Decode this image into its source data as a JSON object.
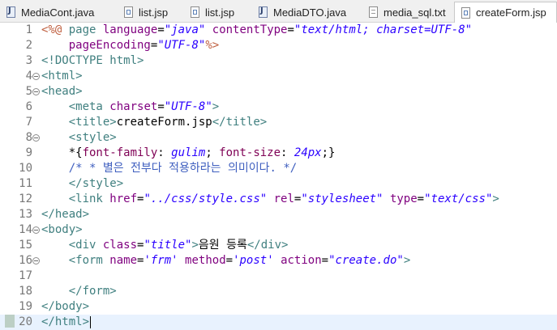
{
  "tabs": [
    {
      "label": "MediaCont.java",
      "icon": "java-file-icon"
    },
    {
      "label": "list.jsp",
      "icon": "jsp-file-icon"
    },
    {
      "label": "list.jsp",
      "icon": "jsp-file-icon"
    },
    {
      "label": "MediaDTO.java",
      "icon": "java-file-icon"
    },
    {
      "label": "media_sql.txt",
      "icon": "text-file-icon"
    },
    {
      "label": "createForm.jsp",
      "icon": "jsp-file-icon",
      "active": true
    }
  ],
  "current_line": 20,
  "lines": [
    {
      "number": "1",
      "fold": false,
      "tokens": [
        [
          "j",
          "<%@ "
        ],
        [
          "t",
          "page "
        ],
        [
          "a",
          "language"
        ],
        [
          "p",
          "="
        ],
        [
          "v",
          "\"java\""
        ],
        [
          "p",
          " "
        ],
        [
          "a",
          "contentType"
        ],
        [
          "p",
          "="
        ],
        [
          "v",
          "\"text/html; charset=UTF-8\""
        ]
      ]
    },
    {
      "number": "2",
      "fold": false,
      "tokens": [
        [
          "p",
          "    "
        ],
        [
          "a",
          "pageEncoding"
        ],
        [
          "p",
          "="
        ],
        [
          "v",
          "\"UTF-8\""
        ],
        [
          "j",
          "%>"
        ]
      ]
    },
    {
      "number": "3",
      "fold": false,
      "tokens": [
        [
          "t",
          "<!DOCTYPE html>"
        ]
      ]
    },
    {
      "number": "4",
      "fold": true,
      "tokens": [
        [
          "t",
          "<html>"
        ]
      ]
    },
    {
      "number": "5",
      "fold": true,
      "tokens": [
        [
          "t",
          "<head>"
        ]
      ]
    },
    {
      "number": "6",
      "fold": false,
      "tokens": [
        [
          "p",
          "    "
        ],
        [
          "t",
          "<meta "
        ],
        [
          "a",
          "charset"
        ],
        [
          "p",
          "="
        ],
        [
          "v",
          "\"UTF-8\""
        ],
        [
          "t",
          ">"
        ]
      ]
    },
    {
      "number": "7",
      "fold": false,
      "tokens": [
        [
          "p",
          "    "
        ],
        [
          "t",
          "<title>"
        ],
        [
          "p",
          "createForm.jsp"
        ],
        [
          "t",
          "</title>"
        ]
      ]
    },
    {
      "number": "8",
      "fold": true,
      "tokens": [
        [
          "p",
          "    "
        ],
        [
          "t",
          "<style>"
        ]
      ]
    },
    {
      "number": "9",
      "fold": false,
      "tokens": [
        [
          "p",
          "    *{"
        ],
        [
          "k",
          "font-family"
        ],
        [
          "p",
          ": "
        ],
        [
          "v",
          "gulim"
        ],
        [
          "p",
          "; "
        ],
        [
          "k",
          "font-size"
        ],
        [
          "p",
          ": "
        ],
        [
          "v",
          "24px"
        ],
        [
          "p",
          ";}"
        ]
      ]
    },
    {
      "number": "10",
      "fold": false,
      "tokens": [
        [
          "p",
          "    "
        ],
        [
          "c",
          "/* * 별은 전부다 적용하라는 의미이다. */"
        ]
      ]
    },
    {
      "number": "11",
      "fold": false,
      "tokens": [
        [
          "p",
          "    "
        ],
        [
          "t",
          "</style>"
        ]
      ]
    },
    {
      "number": "12",
      "fold": false,
      "tokens": [
        [
          "p",
          "    "
        ],
        [
          "t",
          "<link "
        ],
        [
          "a",
          "href"
        ],
        [
          "p",
          "="
        ],
        [
          "v",
          "\"../css/style.css\""
        ],
        [
          "p",
          " "
        ],
        [
          "a",
          "rel"
        ],
        [
          "p",
          "="
        ],
        [
          "v",
          "\"stylesheet\""
        ],
        [
          "p",
          " "
        ],
        [
          "a",
          "type"
        ],
        [
          "p",
          "="
        ],
        [
          "v",
          "\"text/css\""
        ],
        [
          "t",
          ">"
        ]
      ]
    },
    {
      "number": "13",
      "fold": false,
      "tokens": [
        [
          "t",
          "</head>"
        ]
      ]
    },
    {
      "number": "14",
      "fold": true,
      "tokens": [
        [
          "t",
          "<body>"
        ]
      ]
    },
    {
      "number": "15",
      "fold": false,
      "tokens": [
        [
          "p",
          "    "
        ],
        [
          "t",
          "<div "
        ],
        [
          "a",
          "class"
        ],
        [
          "p",
          "="
        ],
        [
          "v",
          "\"title\""
        ],
        [
          "t",
          ">"
        ],
        [
          "p",
          "음원 등록"
        ],
        [
          "t",
          "</div>"
        ]
      ]
    },
    {
      "number": "16",
      "fold": true,
      "tokens": [
        [
          "p",
          "    "
        ],
        [
          "t",
          "<form "
        ],
        [
          "a",
          "name"
        ],
        [
          "p",
          "="
        ],
        [
          "v",
          "'frm'"
        ],
        [
          "p",
          " "
        ],
        [
          "a",
          "method"
        ],
        [
          "p",
          "="
        ],
        [
          "v",
          "'post'"
        ],
        [
          "p",
          " "
        ],
        [
          "a",
          "action"
        ],
        [
          "p",
          "="
        ],
        [
          "v",
          "\"create.do\""
        ],
        [
          "t",
          ">"
        ]
      ]
    },
    {
      "number": "17",
      "fold": false,
      "tokens": []
    },
    {
      "number": "18",
      "fold": false,
      "tokens": [
        [
          "p",
          "    "
        ],
        [
          "t",
          "</form>"
        ]
      ]
    },
    {
      "number": "19",
      "fold": false,
      "tokens": [
        [
          "t",
          "</body>"
        ]
      ]
    },
    {
      "number": "20",
      "fold": false,
      "tokens": [
        [
          "t",
          "</html>"
        ]
      ]
    }
  ],
  "colors": {
    "tag": "#3f7f7f",
    "attribute": "#7f007f",
    "value": "#2a00ff",
    "jsp": "#bf5f3f",
    "comment": "#3f5fbf",
    "css_property": "#7f0055",
    "current_line_bg": "#e8f2fe"
  }
}
